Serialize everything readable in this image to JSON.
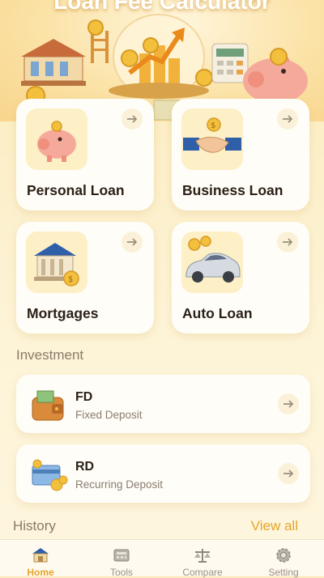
{
  "header": {
    "title": "Loan Fee Calculator"
  },
  "loans": [
    {
      "label": "Personal Loan",
      "icon": "piggy-bank-icon"
    },
    {
      "label": "Business Loan",
      "icon": "handshake-icon"
    },
    {
      "label": "Mortgages",
      "icon": "bank-building-icon"
    },
    {
      "label": "Auto Loan",
      "icon": "car-icon"
    }
  ],
  "investment": {
    "title": "Investment",
    "items": [
      {
        "title": "FD",
        "subtitle": "Fixed Deposit",
        "icon": "wallet-icon"
      },
      {
        "title": "RD",
        "subtitle": "Recurring Deposit",
        "icon": "card-coins-icon"
      }
    ]
  },
  "history": {
    "title": "History",
    "view_all": "View all"
  },
  "nav": [
    {
      "label": "Home",
      "icon": "home-icon",
      "active": true
    },
    {
      "label": "Tools",
      "icon": "tools-icon",
      "active": false
    },
    {
      "label": "Compare",
      "icon": "compare-icon",
      "active": false
    },
    {
      "label": "Setting",
      "icon": "setting-icon",
      "active": false
    }
  ],
  "colors": {
    "accent": "#e6a52a",
    "background": "#fdf2d6",
    "card": "#fffdf7"
  }
}
